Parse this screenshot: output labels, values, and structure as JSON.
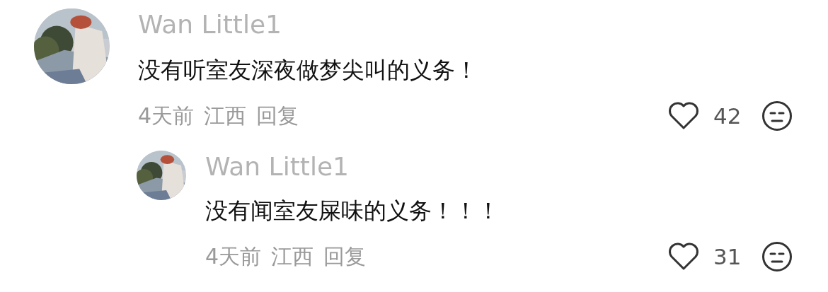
{
  "comments": [
    {
      "author": "Wan Little1",
      "text": "没有听室友深夜做梦尖叫的义务！",
      "time": "4天前",
      "location": "江西",
      "reply_label": "回复",
      "likes": "42",
      "replies": [
        {
          "author": "Wan Little1",
          "text": "没有闻室友屎味的义务！！！",
          "time": "4天前",
          "location": "江西",
          "reply_label": "回复",
          "likes": "31"
        }
      ]
    }
  ]
}
